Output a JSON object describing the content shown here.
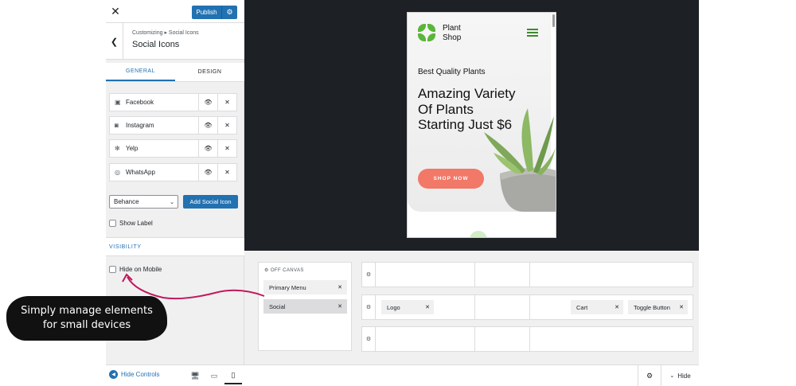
{
  "header": {
    "close_icon": "close-icon",
    "publish_label": "Publish",
    "publish_color": "#2271b1"
  },
  "section": {
    "breadcrumb": "Customizing ▸ Social Icons",
    "title": "Social Icons"
  },
  "tabs": [
    {
      "label": "GENERAL",
      "active": true
    },
    {
      "label": "DESIGN",
      "active": false
    }
  ],
  "social_items": [
    {
      "label": "Facebook",
      "icon": "facebook-icon"
    },
    {
      "label": "Instagram",
      "icon": "instagram-icon"
    },
    {
      "label": "Yelp",
      "icon": "yelp-icon"
    },
    {
      "label": "WhatsApp",
      "icon": "whatsapp-icon"
    }
  ],
  "add_social": {
    "select_value": "Behance",
    "button_label": "Add Social Icon"
  },
  "show_label": {
    "label": "Show Label",
    "checked": false
  },
  "visibility": {
    "heading": "VISIBILITY",
    "hide_on_mobile_label": "Hide on Mobile",
    "hide_on_mobile_checked": false
  },
  "preview": {
    "brand": "Plant\nShop",
    "brand_line1": "Plant",
    "brand_line2": "Shop",
    "tagline": "Best Quality Plants",
    "headline": "Amazing Variety Of Plants Starting Just $6",
    "cta": "SHOP NOW",
    "accent_color": "#f27868",
    "brand_color": "#5bb53b"
  },
  "builder": {
    "off_canvas_label": "OFF CANVAS",
    "off_canvas_items": [
      {
        "label": "Primary Menu",
        "selected": false
      },
      {
        "label": "Social",
        "selected": true
      }
    ],
    "middle_row": {
      "logo": "Logo",
      "cart": "Cart",
      "toggle": "Toggle Button"
    }
  },
  "bottom_bar": {
    "hide_controls": "Hide Controls",
    "hide": "Hide",
    "devices": [
      "desktop-icon",
      "tablet-icon",
      "mobile-icon"
    ],
    "active_device": "mobile-icon"
  },
  "annotation": {
    "text_line1": "Simply manage elements",
    "text_line2": "for small devices"
  }
}
